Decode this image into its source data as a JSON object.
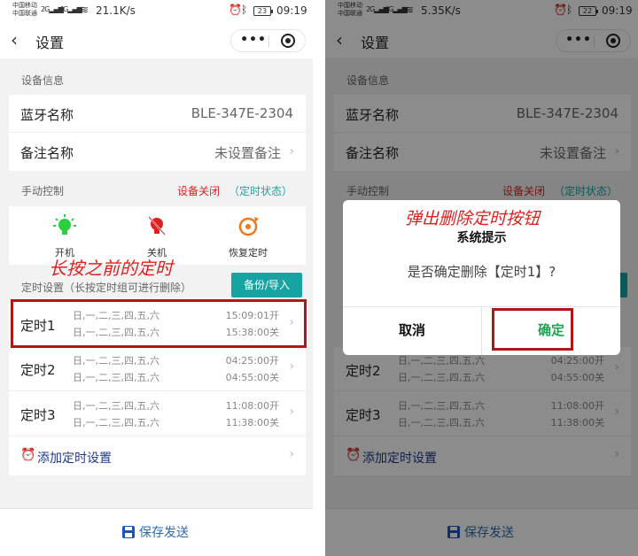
{
  "left": {
    "status": {
      "carrier1": "中国移动",
      "carrier2": "中国联通",
      "signal1": "2G▂▄▆",
      "signal2": "4G▂▄▆",
      "speed": "21.1K/s",
      "battery": "23",
      "time": "09:19"
    },
    "nav": {
      "title": "设置",
      "more": "•••"
    },
    "device_info": {
      "section": "设备信息",
      "bt_label": "蓝牙名称",
      "bt_value": "BLE-347E-2304",
      "remark_label": "备注名称",
      "remark_value": "未设置备注"
    },
    "manual": {
      "section": "手动控制",
      "status_off": "设备关闭",
      "status_timer": "（定时状态）",
      "controls": [
        {
          "label": "开机"
        },
        {
          "label": "关机"
        },
        {
          "label": "恢复定时"
        }
      ]
    },
    "timer": {
      "section": "定时设置（长按定时组可进行删除）",
      "backup_btn": "备份/导入",
      "items": [
        {
          "name": "定时1",
          "days1": "日,一,二,三,四,五,六",
          "days2": "日,一,二,三,四,五,六",
          "time1": "15:09:01开",
          "time2": "15:38:00关"
        },
        {
          "name": "定时2",
          "days1": "日,一,二,三,四,五,六",
          "days2": "日,一,二,三,四,五,六",
          "time1": "04:25:00开",
          "time2": "04:55:00关"
        },
        {
          "name": "定时3",
          "days1": "日,一,二,三,四,五,六",
          "days2": "日,一,二,三,四,五,六",
          "time1": "11:08:00开",
          "time2": "11:38:00关"
        }
      ],
      "add_label": "添加定时设置"
    },
    "footer": {
      "save_label": "保存发送"
    },
    "annotation": "长按之前的定时"
  },
  "right": {
    "status": {
      "carrier1": "中国移动",
      "carrier2": "中国联通",
      "signal1": "2G▂▄▆",
      "signal2": "4G▂▄▆",
      "speed": "5.35K/s",
      "battery": "22",
      "time": "09:19"
    },
    "nav": {
      "title": "设置",
      "more": "•••"
    },
    "device_info": {
      "section": "设备信息",
      "bt_label": "蓝牙名称",
      "bt_value": "BLE-347E-2304",
      "remark_label": "备注名称",
      "remark_value": "未设置备注"
    },
    "manual": {
      "section": "手动控制",
      "status_off": "设备关闭",
      "status_timer": "（定时状态）"
    },
    "timer": {
      "items": [
        {
          "name": "定时2",
          "days1": "日,一,二,三,四,五,六",
          "days2": "日,一,二,三,四,五,六",
          "time1": "04:25:00开",
          "time2": "04:55:00关"
        },
        {
          "name": "定时3",
          "days1": "日,一,二,三,四,五,六",
          "days2": "日,一,二,三,四,五,六",
          "time1": "11:08:00开",
          "time2": "11:38:00关"
        }
      ],
      "add_label": "添加定时设置"
    },
    "footer": {
      "save_label": "保存发送"
    },
    "dialog": {
      "title": "系统提示",
      "message": "是否确定删除【定时1】?",
      "cancel": "取消",
      "confirm": "确定"
    },
    "annotation": "弹出删除定时按钮"
  },
  "colors": {
    "accent_teal": "#18a3a3",
    "alert_red": "#e02020",
    "link_blue": "#1e3a8a",
    "confirm_green": "#1aa350"
  }
}
